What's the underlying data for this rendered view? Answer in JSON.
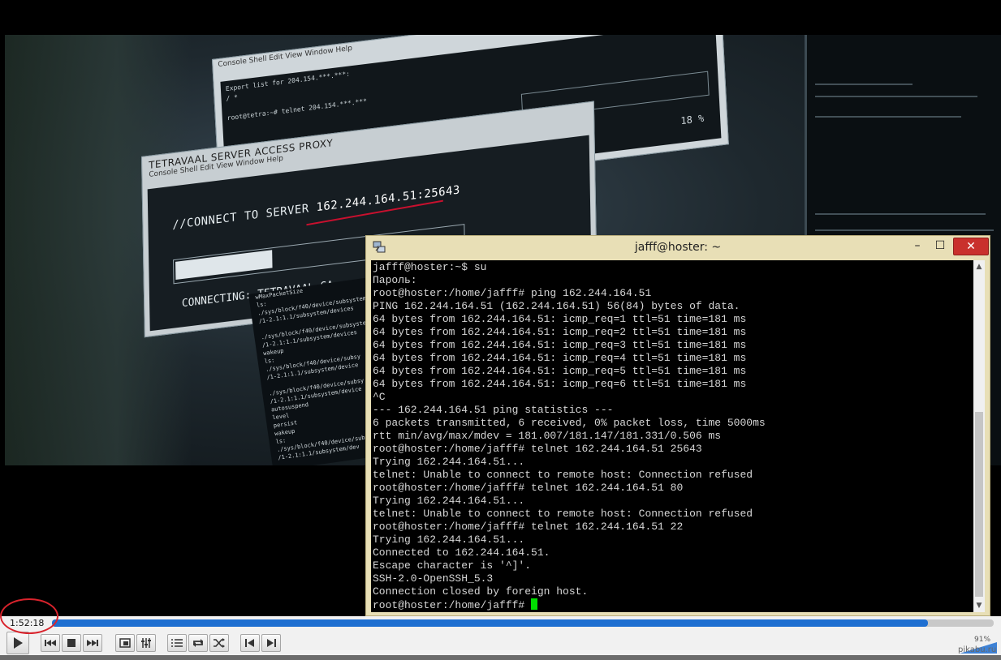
{
  "terminal": {
    "title": "jafff@hoster: ~",
    "controls": {
      "minimize": "–",
      "maximize": "☐",
      "close": "✕"
    },
    "lines": [
      "jafff@hoster:~$ su",
      "Пароль:",
      "root@hoster:/home/jafff# ping 162.244.164.51",
      "PING 162.244.164.51 (162.244.164.51) 56(84) bytes of data.",
      "64 bytes from 162.244.164.51: icmp_req=1 ttl=51 time=181 ms",
      "64 bytes from 162.244.164.51: icmp_req=2 ttl=51 time=181 ms",
      "64 bytes from 162.244.164.51: icmp_req=3 ttl=51 time=181 ms",
      "64 bytes from 162.244.164.51: icmp_req=4 ttl=51 time=181 ms",
      "64 bytes from 162.244.164.51: icmp_req=5 ttl=51 time=181 ms",
      "64 bytes from 162.244.164.51: icmp_req=6 ttl=51 time=181 ms",
      "^C",
      "--- 162.244.164.51 ping statistics ---",
      "6 packets transmitted, 6 received, 0% packet loss, time 5000ms",
      "rtt min/avg/max/mdev = 181.007/181.147/181.331/0.506 ms",
      "root@hoster:/home/jafff# telnet 162.244.164.51 25643",
      "Trying 162.244.164.51...",
      "telnet: Unable to connect to remote host: Connection refused",
      "root@hoster:/home/jafff# telnet 162.244.164.51 80",
      "Trying 162.244.164.51...",
      "telnet: Unable to connect to remote host: Connection refused",
      "root@hoster:/home/jafff# telnet 162.244.164.51 22",
      "Trying 162.244.164.51...",
      "Connected to 162.244.164.51.",
      "Escape character is '^]'.",
      "SSH-2.0-OpenSSH_5.3",
      "Connection closed by foreign host."
    ],
    "prompt": "root@hoster:/home/jafff# ",
    "cursor_color": "#00e000"
  },
  "video": {
    "back_window": {
      "menu": "Console   Shell   Edit   View   Window   Help",
      "text": [
        "Export list for 204.154.***.***:",
        "/ *",
        "",
        "root@tetra:~# telnet 204.154.***.***"
      ],
      "percent": "18 %"
    },
    "proxy_window": {
      "title": "TETRAVAAL SERVER ACCESS PROXY",
      "menu": "Console   Shell   Edit   View   Window   Help",
      "connect_label": "//CONNECT TO SERVER ",
      "connect_ip": "162.244.164.51:25643",
      "connecting": "CONNECTING: TETRAVAAL_SA..."
    },
    "left_log": [
      "wMaxPacketSize",
      "ls:",
      "./sys/block/f40/device/subsystem",
      "/1-2.1:1.1/subsystem/devices",
      "",
      "./sys/block/f40/device/subsystem",
      "/1-2.1:1.1/subsystem/devices",
      "wakeup",
      "ls:",
      "./sys/block/f40/device/subsy",
      "/1-2.1:1.1/subsystem/device",
      "",
      "./sys/block/f40/device/subsy",
      "/1-2.1:1.1/subsystem/device",
      "autosuspend",
      "level",
      "persist",
      "wakeup",
      "ls:",
      "./sys/block/f40/device/sub",
      "/1-2.1:1.1/subsystem/dev"
    ]
  },
  "player": {
    "time": "1:52:18",
    "progress": 0.93,
    "volume": "91%",
    "watermark": "pikabu.ru",
    "accent": "#1f6fd1",
    "annotation_color": "#d9232c"
  }
}
